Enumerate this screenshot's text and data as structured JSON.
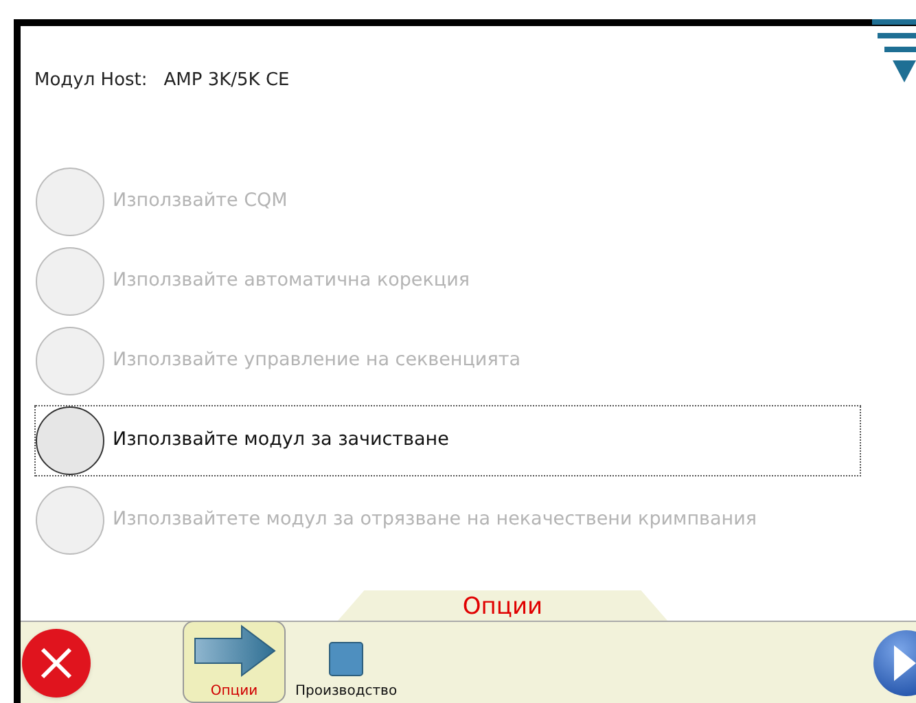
{
  "header": {
    "label": "Модул Host:",
    "value": "AMP 3K/5K CE"
  },
  "options": [
    {
      "label": "Използвайте CQM",
      "disabled": true,
      "focused": false
    },
    {
      "label": "Използвайте автоматична корекция",
      "disabled": true,
      "focused": false
    },
    {
      "label": "Използвайте управление на секвенцията",
      "disabled": true,
      "focused": false
    },
    {
      "label": "Използвайте модул за зачистване",
      "disabled": false,
      "focused": true
    },
    {
      "label": "Използвайтете модул за отрязване на некачествени кримпвания",
      "disabled": true,
      "focused": false
    }
  ],
  "panel_tab": {
    "title": "Опции"
  },
  "modes": [
    {
      "kind": "arrow",
      "label": "Опции",
      "selected": true
    },
    {
      "kind": "square",
      "label": "Производство",
      "selected": false
    }
  ]
}
